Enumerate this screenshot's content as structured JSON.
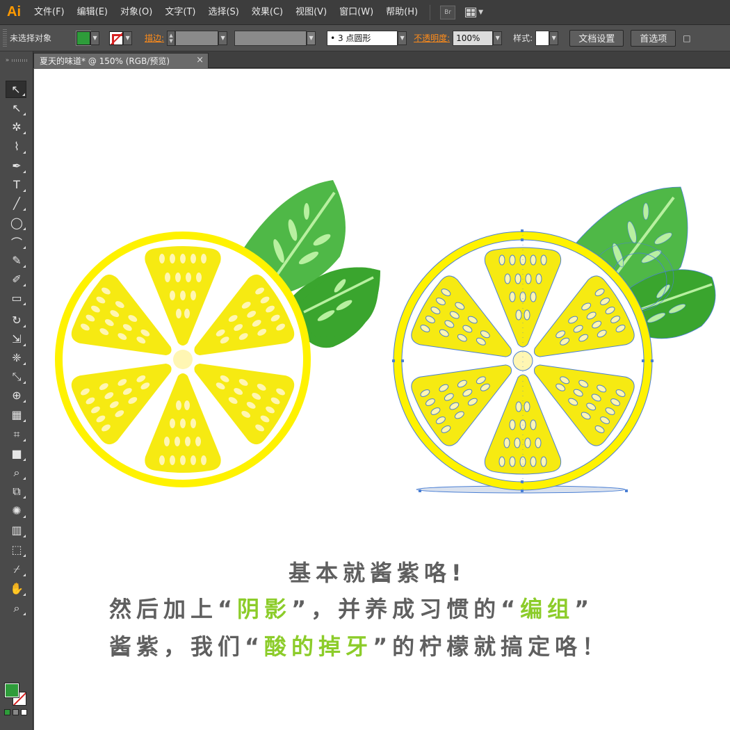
{
  "app": {
    "logo": "Ai"
  },
  "menu": [
    "文件(F)",
    "编辑(E)",
    "对象(O)",
    "文字(T)",
    "选择(S)",
    "效果(C)",
    "视图(V)",
    "窗口(W)",
    "帮助(H)"
  ],
  "menubar_icons": {
    "bridge_label": "Br",
    "arrange_icon": "workspace-grid-icon"
  },
  "control": {
    "selection_label": "未选择对象",
    "stroke_label": "描边",
    "brush_value": "3 点圆形",
    "opacity_label": "不透明度",
    "opacity_value": "100%",
    "style_label": "样式",
    "doc_setup_button": "文档设置",
    "preferences_button": "首选项",
    "tail_text": "□",
    "fill_color": "#2e9c3a",
    "stroke_color": "none"
  },
  "document": {
    "tab_title": "夏天的味道* @ 150% (RGB/预览)",
    "close_symbol": "×"
  },
  "tools": [
    "selection-tool",
    "direct-selection-tool",
    "magic-wand-tool",
    "lasso-tool",
    "pen-tool",
    "type-tool",
    "line-tool",
    "ellipse-tool",
    "paintbrush-tool",
    "pencil-tool",
    "blob-brush-tool",
    "eraser-tool",
    "rotate-tool",
    "scale-tool",
    "warp-tool",
    "free-transform-tool",
    "shape-builder-tool",
    "perspective-grid-tool",
    "mesh-tool",
    "gradient-tool",
    "eyedropper-tool",
    "blend-tool",
    "symbol-sprayer-tool",
    "column-graph-tool",
    "artboard-tool",
    "slice-tool",
    "hand-tool",
    "zoom-tool"
  ],
  "caption": {
    "line1": "基本就酱紫咯!",
    "line2_a": "然后加上“",
    "line2_hl1": "阴影",
    "line2_b": "”，并养成习惯的“",
    "line2_hl2": "编组",
    "line2_c": "”",
    "line3_a": "酱紫，我们“",
    "line3_hl": "酸的掉牙",
    "line3_b": "”的柠檬就搞定咯！"
  },
  "colors": {
    "lemon_yellow": "#fff200",
    "lemon_inner": "#f6ea12",
    "seed": "#fff6b3",
    "leaf_dark": "#3aa52e",
    "leaf_mid": "#4fb847",
    "leaf_vein": "#b8f0a0",
    "caption_gray": "#5f5f5f",
    "caption_highlight": "#8ccc2a",
    "selection_blue": "#4a7fd4"
  }
}
